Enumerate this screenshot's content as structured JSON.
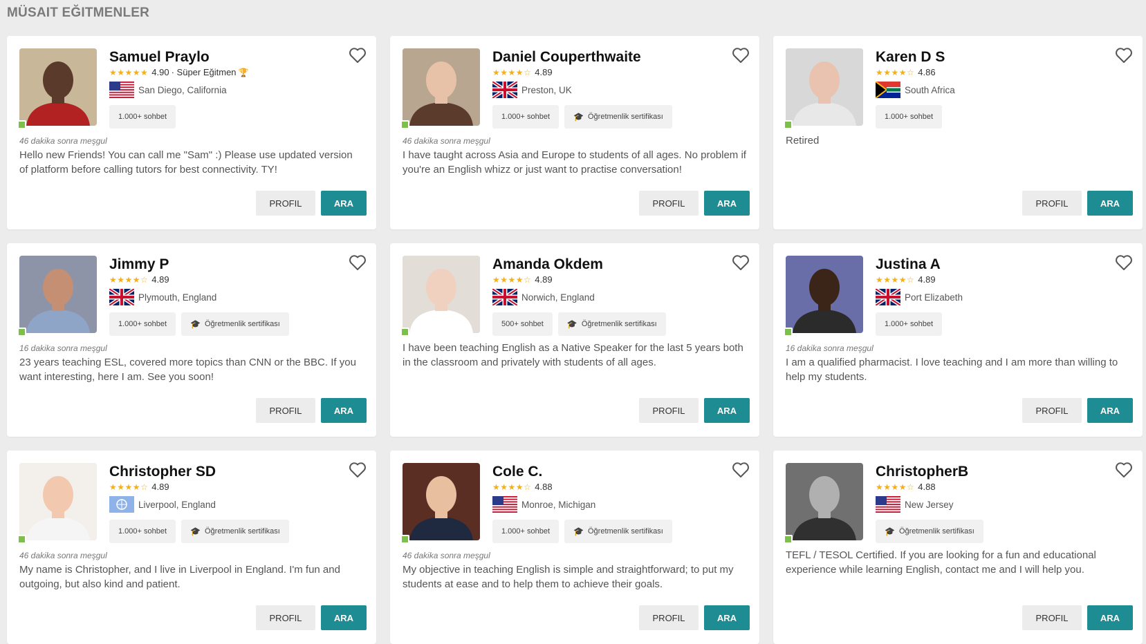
{
  "section_title": "MÜSAIT EĞITMENLER",
  "colors": {
    "accent": "#1e8c93",
    "online": "#7cc04b",
    "star": "#f2b01e",
    "background": "#ececec"
  },
  "buttons": {
    "profile": "PROFIL",
    "call": "ARA"
  },
  "tutors": [
    {
      "name": "Samuel Praylo",
      "stars": "★★★★★",
      "rating": "4.90",
      "super": "· Süper Eğitmen",
      "flag": "us",
      "location": "San Diego, California",
      "tags": [
        "1.000+ sohbet"
      ],
      "cert": "",
      "busy": "46 dakika sonra meşgul",
      "bio": "Hello new Friends! You can call me \"Sam\" :) Please use updated version of platform before calling tutors for best connectivity. TY!"
    },
    {
      "name": "Daniel Couperthwaite",
      "stars": "★★★★☆",
      "rating": "4.89",
      "super": "",
      "flag": "uk",
      "location": "Preston, UK",
      "tags": [
        "1.000+ sohbet"
      ],
      "cert": "Öğretmenlik sertifikası",
      "busy": "46 dakika sonra meşgul",
      "bio": "I have taught across Asia and Europe to students of all ages. No problem if you're an English whizz or just want to practise conversation!"
    },
    {
      "name": "Karen D S",
      "stars": "★★★★☆",
      "rating": "4.86",
      "super": "",
      "flag": "za",
      "location": "South Africa",
      "tags": [
        "1.000+ sohbet"
      ],
      "cert": "",
      "busy": "",
      "bio": "Retired"
    },
    {
      "name": "Jimmy P",
      "stars": "★★★★☆",
      "rating": "4.89",
      "super": "",
      "flag": "uk",
      "location": "Plymouth, England",
      "tags": [
        "1.000+ sohbet"
      ],
      "cert": "Öğretmenlik sertifikası",
      "busy": "16 dakika sonra meşgul",
      "bio": "23 years teaching ESL, covered more topics than CNN or the BBC. If you want interesting, here I am. See you soon!"
    },
    {
      "name": "Amanda Okdem",
      "stars": "★★★★☆",
      "rating": "4.89",
      "super": "",
      "flag": "uk",
      "location": "Norwich, England",
      "tags": [
        "500+ sohbet"
      ],
      "cert": "Öğretmenlik sertifikası",
      "busy": "",
      "bio": "I have been teaching English as a Native Speaker for the last 5 years both in the classroom and privately with students of all ages."
    },
    {
      "name": "Justina A",
      "stars": "★★★★☆",
      "rating": "4.89",
      "super": "",
      "flag": "uk",
      "location": "Port Elizabeth",
      "tags": [
        "1.000+ sohbet"
      ],
      "cert": "",
      "busy": "16 dakika sonra meşgul",
      "bio": "I am a qualified pharmacist. I love teaching and I am more than willing to help my students."
    },
    {
      "name": "Christopher SD",
      "stars": "★★★★☆",
      "rating": "4.89",
      "super": "",
      "flag": "un",
      "location": "Liverpool, England",
      "tags": [
        "1.000+ sohbet"
      ],
      "cert": "Öğretmenlik sertifikası",
      "busy": "46 dakika sonra meşgul",
      "bio": "My name is Christopher, and I live in Liverpool in England. I'm fun and outgoing, but also kind and patient."
    },
    {
      "name": "Cole C.",
      "stars": "★★★★☆",
      "rating": "4.88",
      "super": "",
      "flag": "us",
      "location": "Monroe, Michigan",
      "tags": [
        "1.000+ sohbet"
      ],
      "cert": "Öğretmenlik sertifikası",
      "busy": "46 dakika sonra meşgul",
      "bio": "My objective in teaching English is simple and straightforward; to put my students at ease and to help them to achieve their goals."
    },
    {
      "name": "ChristopherB",
      "stars": "★★★★☆",
      "rating": "4.88",
      "super": "",
      "flag": "us",
      "location": "New Jersey",
      "tags": [],
      "cert": "Öğretmenlik sertifikası",
      "busy": "",
      "bio": "TEFL / TESOL Certified. If you are looking for a fun and educational experience while learning English, contact me and I will help you."
    }
  ]
}
